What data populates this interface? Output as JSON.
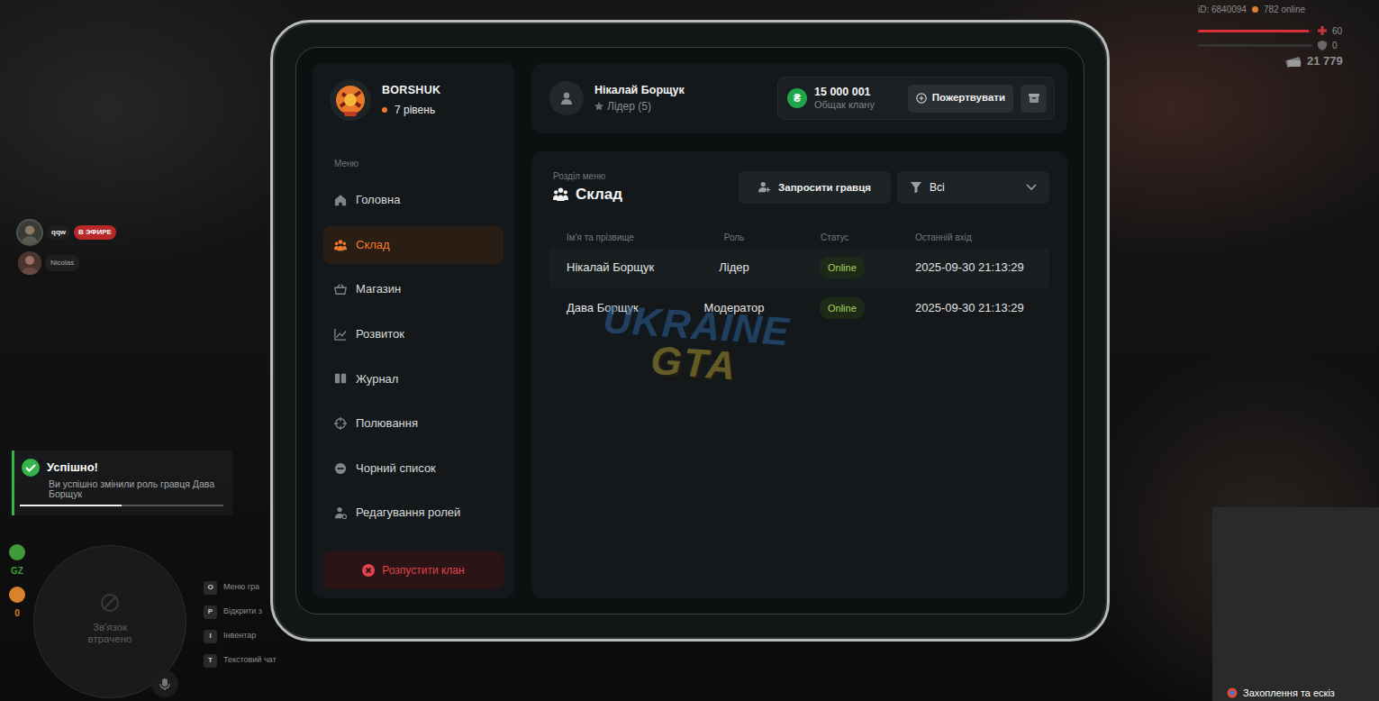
{
  "hud": {
    "player_id": "iD: 6840094",
    "online": "782 online",
    "health": "60",
    "health_level": 0.97,
    "armor": "0",
    "armor_level": 0,
    "money": "21 779"
  },
  "stream": {
    "user": "qqw",
    "badge": "В ЭФИРЕ",
    "viewer": "Nicolas"
  },
  "notification": {
    "title": "Успішно!",
    "message": "Ви успішно змінили роль гравця Дава Борщук",
    "level": 0.5
  },
  "side_status": [
    {
      "label": "GZ",
      "color": "#3f9a3a"
    },
    {
      "label": "0",
      "color": "#d9822b"
    }
  ],
  "minimap": {
    "text": "Зв'язок втрачено"
  },
  "hints": [
    {
      "key": "O",
      "label": "Меню гра"
    },
    {
      "key": "P",
      "label": "Відкрити з"
    },
    {
      "key": "I",
      "label": "Інвентар"
    },
    {
      "key": "T",
      "label": "Текстовий чат"
    }
  ],
  "capture": {
    "text": "Захоплення та ескіз"
  },
  "clan": {
    "name": "BORSHUK",
    "level": "7 рівень"
  },
  "sidebar": {
    "heading": "Меню",
    "items": [
      {
        "label": "Головна",
        "selected": false
      },
      {
        "label": "Склад",
        "selected": true
      },
      {
        "label": "Магазин",
        "selected": false
      },
      {
        "label": "Розвиток",
        "selected": false
      },
      {
        "label": "Журнал",
        "selected": false
      },
      {
        "label": "Полювання",
        "selected": false
      },
      {
        "label": "Чорний список",
        "selected": false
      },
      {
        "label": "Редагування ролей",
        "selected": false
      }
    ],
    "disband": "Розпустити клан"
  },
  "profile": {
    "name": "Нікалай Борщук",
    "role": "Лідер (5)"
  },
  "treasury": {
    "currency": "₴",
    "amount": "15 000 001",
    "label": "Общак клану",
    "donate": "Пожертвувати"
  },
  "section": {
    "caption": "Розділ меню",
    "title": "Склад",
    "invite": "Запросити гравця",
    "filter": "Всі"
  },
  "table": {
    "columns": [
      "Ім'я та прізвище",
      "Роль",
      "Статус",
      "Останній вхід"
    ],
    "rows": [
      {
        "cells": [
          "Нікалай Борщук",
          "Лідер",
          "Online",
          "2025-09-30 21:13:29"
        ],
        "selected": true
      },
      {
        "cells": [
          "Дава Борщук",
          "Модератор",
          "Online",
          "2025-09-30 21:13:29"
        ],
        "selected": false
      }
    ]
  },
  "watermark": {
    "top": "UKRAINE",
    "bottom": "GTA"
  }
}
